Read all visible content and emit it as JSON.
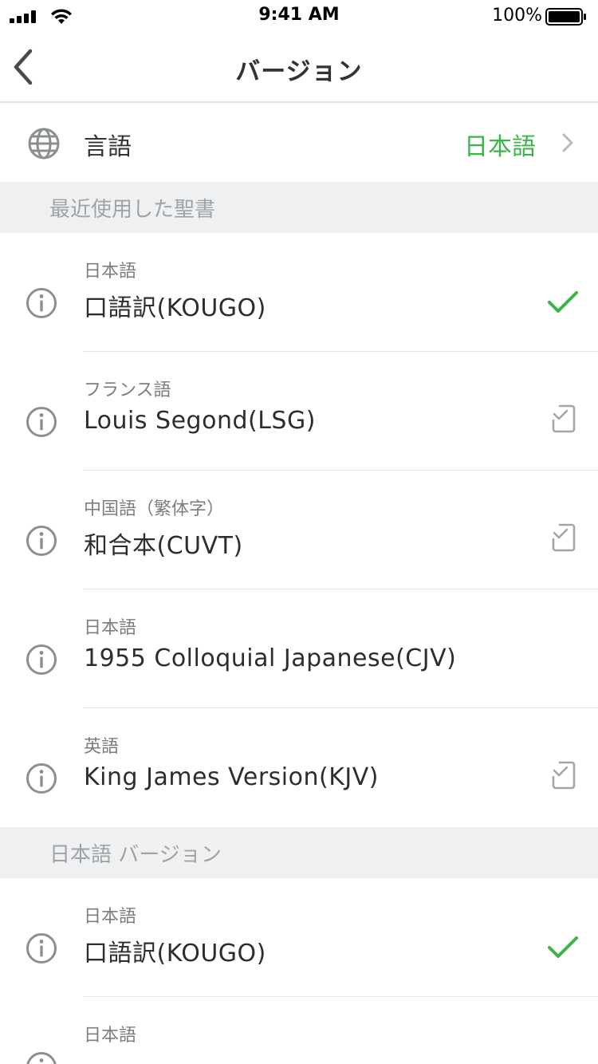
{
  "status_bar": {
    "time": "9:41 AM",
    "battery": "100%"
  },
  "nav": {
    "title": "バージョン"
  },
  "language": {
    "label": "言語",
    "value": "日本語",
    "value_color": "#3ab54a"
  },
  "sections": [
    {
      "title": "最近使用した聖書",
      "items": [
        {
          "lang": "日本語",
          "name": "口語訳(KOUGO)",
          "status": "selected"
        },
        {
          "lang": "フランス語",
          "name": "Louis Segond(LSG)",
          "status": "downloaded"
        },
        {
          "lang": "中国語（繁体字）",
          "name": "和合本(CUVT)",
          "status": "downloaded"
        },
        {
          "lang": "日本語",
          "name": "1955 Colloquial Japanese(CJV)",
          "status": "none"
        },
        {
          "lang": "英語",
          "name": "King James Version(KJV)",
          "status": "downloaded"
        }
      ]
    },
    {
      "title": "日本語 バージョン",
      "items": [
        {
          "lang": "日本語",
          "name": "口語訳(KOUGO)",
          "status": "selected"
        },
        {
          "lang": "日本語",
          "name": "",
          "status": "none"
        }
      ]
    }
  ],
  "icons": {
    "back": "chevron-left-icon",
    "globe": "globe-icon",
    "info": "info-icon",
    "selected": "checkmark-icon",
    "downloaded": "device-check-icon"
  },
  "colors": {
    "accent": "#3ab54a",
    "section_bg": "#eef0f1"
  }
}
